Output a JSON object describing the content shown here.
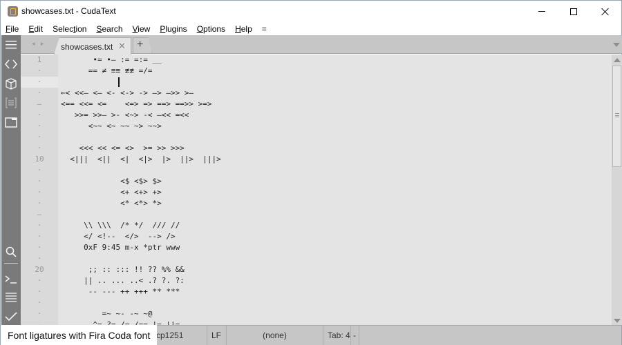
{
  "titlebar": {
    "title": "showcases.txt - CudaText",
    "app_icon": "cudatext-app-icon",
    "controls": [
      "minimize",
      "maximize",
      "close"
    ]
  },
  "menubar": {
    "items": [
      {
        "label": "File",
        "mnemonic": "F",
        "rest": "ile"
      },
      {
        "label": "Edit",
        "mnemonic": "E",
        "rest": "dit"
      },
      {
        "label": "Selection",
        "pre": "Selec",
        "mnemonic": "t",
        "rest": "ion"
      },
      {
        "label": "Search",
        "mnemonic": "S",
        "rest": "earch"
      },
      {
        "label": "View",
        "mnemonic": "V",
        "rest": "iew"
      },
      {
        "label": "Plugins",
        "mnemonic": "P",
        "rest": "lugins"
      },
      {
        "label": "Options",
        "mnemonic": "O",
        "rest": "ptions"
      },
      {
        "label": "Help",
        "mnemonic": "H",
        "rest": "elp"
      },
      {
        "label": "="
      }
    ]
  },
  "sidebar": {
    "top_icons": [
      "menu-icon",
      "code-tree-icon",
      "project-icon",
      "snippets-icon",
      "tabs-icon"
    ],
    "bottom_icons": [
      "search-icon",
      "console-icon",
      "output-icon",
      "validate-icon"
    ]
  },
  "tabs": {
    "nav": "◂ ▸",
    "items": [
      {
        "label": "showcases.txt",
        "close": "✕",
        "active": true
      }
    ],
    "add_label": "+"
  },
  "editor": {
    "gutter": [
      "1",
      "·",
      "·",
      "·",
      "–",
      "·",
      "·",
      "·",
      "·",
      "10",
      "·",
      "·",
      "·",
      "·",
      "–",
      "·",
      "·",
      "·",
      "·",
      "20",
      "·",
      "·",
      "·",
      "·",
      "–"
    ],
    "lines": [
      "       •= •– := =:= __",
      "      == ≠ ≡≡ ≢≢ =/=",
      "",
      "←< <<– <– <- <-> -> –> –>> >–",
      "<== <<= <=    <=> => ==> ==>> >=>",
      "   >>= >>– >- <~> -< –<< =<<",
      "      <~~ <~ ~~ ~> ~~>",
      "",
      "    <<< << <= <>  >= >> >>>",
      "  <|||  <||  <|  <|>  |>  ||>  |||>",
      "",
      "             <$ <$> $>",
      "             <+ <+> +>",
      "             <* <*> *>",
      "",
      "     \\\\ \\\\\\  /* */  /// //",
      "     </ <!--  </>  --> />",
      "     0xF 9:45 m-x *ptr www",
      "",
      "      ;; :: ::: !! ?? %% &&",
      "     || .. ... ..< .? ?. ?:",
      "      -- --- ++ +++ ** ***",
      "",
      "         =~ ~- -~ ~@",
      "       ^= ?= /= /== |= ||="
    ]
  },
  "statusbar": {
    "encoding": "cp1251",
    "line_ending": "LF",
    "lexer": "(none)",
    "tab_size": "Tab: 4",
    "extra": "-"
  },
  "caption": {
    "text": "Font ligatures with Fira Coda font"
  },
  "colors": {
    "sidebar_bg": "#7a7a7a",
    "tabbar_bg": "#c6c6c6",
    "editor_bg": "#e4e4e4",
    "gutter_bg": "#dadada",
    "statusbar_bg": "#c6c6c6"
  }
}
